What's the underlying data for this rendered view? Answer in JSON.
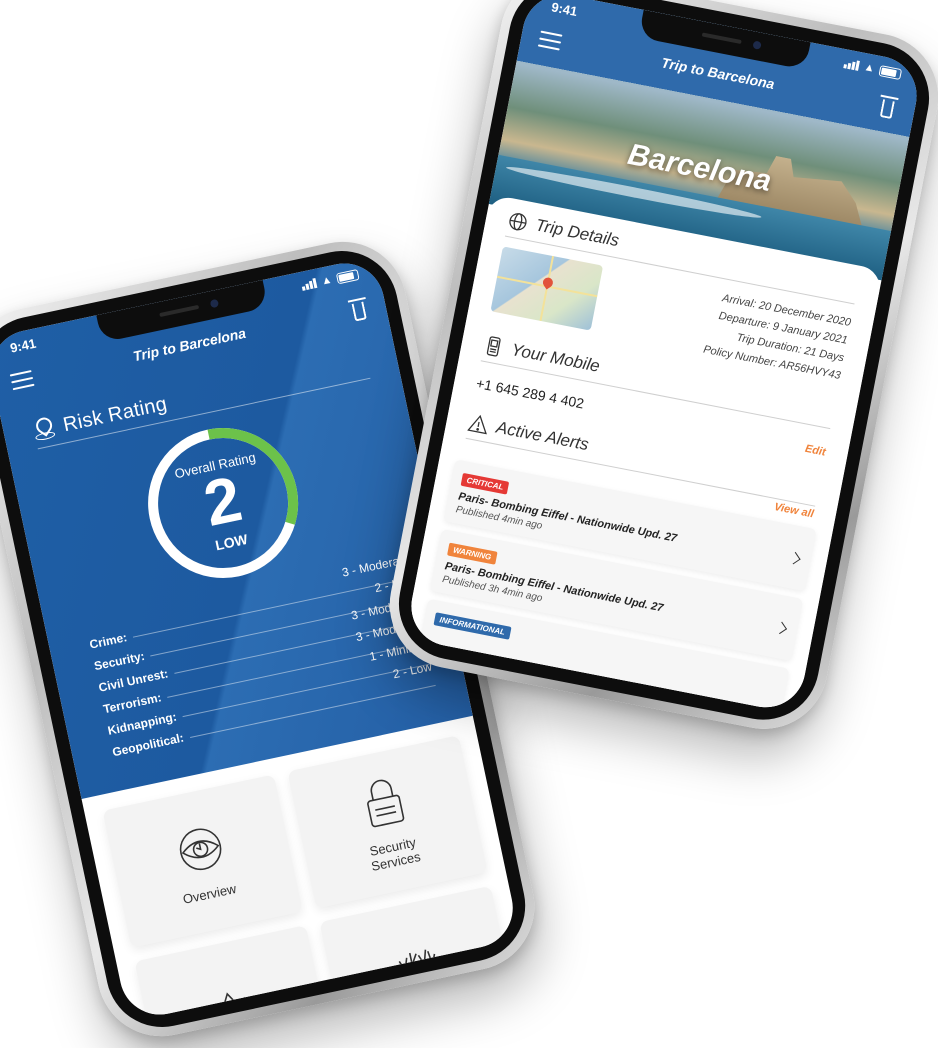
{
  "phone_left": {
    "status_time": "9:41",
    "title": "Trip to Barcelona",
    "risk_heading": "Risk Rating",
    "overall": {
      "label": "Overall Rating",
      "value": "2",
      "level": "LOW",
      "fill_fraction": 0.33
    },
    "ratings": [
      {
        "category": "Crime:",
        "value": "3 - Moderate"
      },
      {
        "category": "Security:",
        "value": "2 - Low"
      },
      {
        "category": "Civil Unrest:",
        "value": "3 - Moderate"
      },
      {
        "category": "Terrorism:",
        "value": "3 - Moderate"
      },
      {
        "category": "Kidnapping:",
        "value": "1 - Minimal"
      },
      {
        "category": "Geopolitical:",
        "value": "2 - Low"
      }
    ],
    "tiles": [
      {
        "label": "Overview",
        "icon": "eye-icon"
      },
      {
        "label": "Security\nServices",
        "icon": "padlock-icon"
      },
      {
        "label": "",
        "icon": "mountain-icon"
      },
      {
        "label": "",
        "icon": "raised-hands-icon"
      }
    ]
  },
  "phone_right": {
    "status_time": "9:41",
    "title": "Trip to Barcelona",
    "city": "Barcelona",
    "trip_details_heading": "Trip Details",
    "trip_info": [
      "Arrival: 20 December 2020",
      "Departure: 9 January 2021",
      "Trip Duration: 21 Days",
      "Policy Number: AR56HVY43"
    ],
    "mobile_heading": "Your Mobile",
    "mobile_number": "+1  645  289 4 402",
    "edit_label": "Edit",
    "alerts_heading": "Active Alerts",
    "view_all_label": "View all",
    "alerts": [
      {
        "badge": "CRITICAL",
        "badge_color": "#e53935",
        "title": "Paris- Bombing Eiffel  - Nationwide Upd. 27",
        "time": "Published 4min ago"
      },
      {
        "badge": "WARNING",
        "badge_color": "#f0843c",
        "title": "Paris- Bombing Eiffel  - Nationwide Upd. 27",
        "time": "Published 3h 4min ago"
      },
      {
        "badge": "INFORMATIONAL",
        "badge_color": "#2f6aab",
        "title": "",
        "time": ""
      }
    ]
  },
  "colors": {
    "primary_blue": "#1f5fa6",
    "gauge_green": "#6cc24a",
    "accent_orange": "#f0843c",
    "critical_red": "#e53935"
  }
}
